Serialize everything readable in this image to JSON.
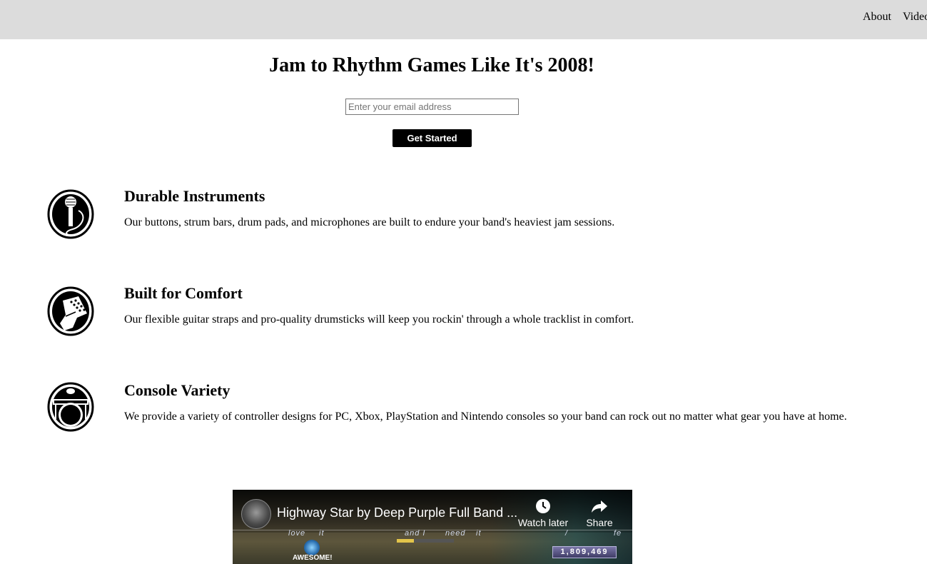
{
  "header": {
    "nav": [
      "About",
      "Video"
    ]
  },
  "hero": {
    "title": "Jam to Rhythm Games Like It's 2008!",
    "email_placeholder": "Enter your email address",
    "cta_label": "Get Started"
  },
  "features": [
    {
      "icon": "microphone-icon",
      "title": "Durable Instruments",
      "description": "Our buttons, strum bars, drum pads, and microphones are built to endure your band's heaviest jam sessions."
    },
    {
      "icon": "guitar-headstock-icon",
      "title": "Built for Comfort",
      "description": "Our flexible guitar straps and pro-quality drumsticks will keep you rockin' through a whole tracklist in comfort."
    },
    {
      "icon": "drum-kit-icon",
      "title": "Console Variety",
      "description": "We provide a variety of controller designs for PC, Xbox, PlayStation and Nintendo consoles so your band can rock out no matter what gear you have at home."
    }
  ],
  "video": {
    "title": "Highway Star by Deep Purple Full Band ...",
    "watch_later_label": "Watch later",
    "share_label": "Share",
    "lyrics": [
      "love",
      "it",
      "and I",
      "need",
      "it",
      "/",
      "fe"
    ],
    "score": "1,809,469",
    "rating_text": "AWESOME!",
    "star_meter_fraction": 0.3
  },
  "colors": {
    "header_bg": "#dcdcdc",
    "cta_bg": "#000000",
    "cta_text": "#ffffff"
  }
}
